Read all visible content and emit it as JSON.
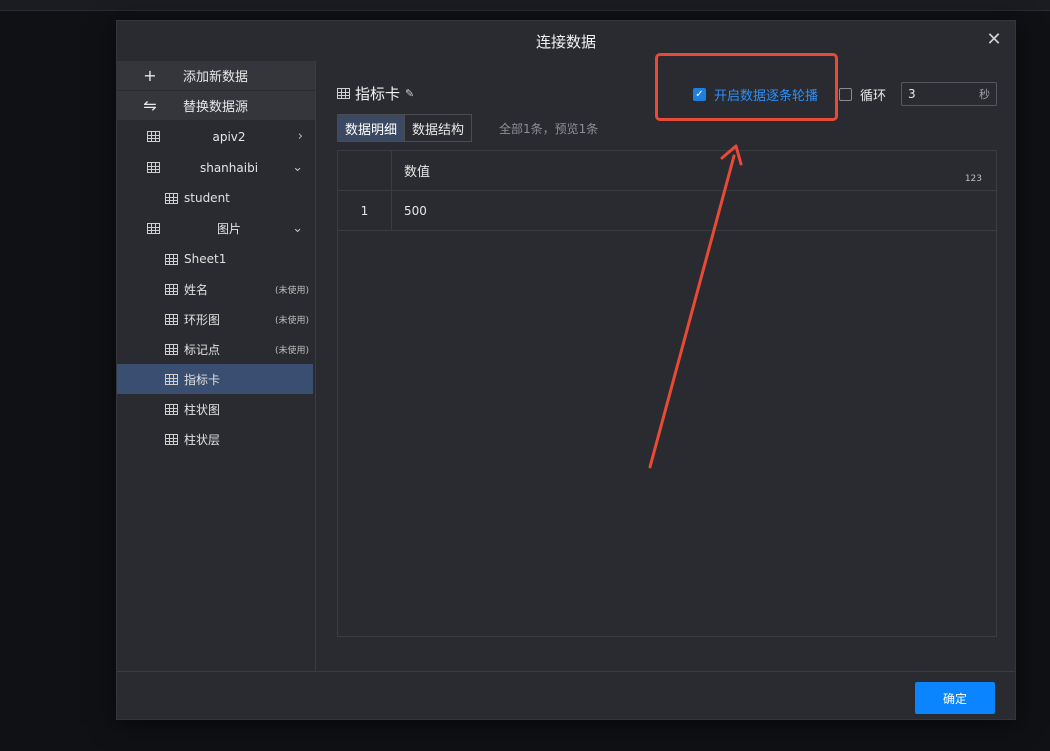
{
  "dialog": {
    "title": "连接数据",
    "close_label": "✕"
  },
  "sidebar": {
    "actions": [
      {
        "icon": "+",
        "label": "添加新数据"
      },
      {
        "icon": "⇋",
        "label": "替换数据源"
      }
    ],
    "sources": [
      {
        "label": "apiv2",
        "chevron": "›"
      },
      {
        "label": "shanhaibi",
        "chevron": "⌄"
      },
      {
        "label": "图片",
        "chevron": "⌄"
      }
    ],
    "shanhaibi_sheets": [
      {
        "label": "student"
      }
    ],
    "image_sheets": [
      {
        "label": "Sheet1",
        "tag": ""
      },
      {
        "label": "姓名",
        "tag": "(未使用)"
      },
      {
        "label": "环形图",
        "tag": "(未使用)"
      },
      {
        "label": "标记点",
        "tag": "(未使用)"
      },
      {
        "label": "指标卡",
        "tag": "",
        "active": true
      },
      {
        "label": "柱状图",
        "tag": ""
      },
      {
        "label": "柱状层",
        "tag": ""
      }
    ]
  },
  "main": {
    "sheet_title": "指标卡",
    "tabs": [
      "数据明细",
      "数据结构"
    ],
    "active_tab": "数据明细",
    "summary": "全部1条，预览1条",
    "rotate_label": "开启数据逐条轮播",
    "rotate_checked": true,
    "loop_label": "循环",
    "loop_checked": false,
    "seconds_value": "3",
    "seconds_unit": "秒",
    "table": {
      "column_header": "数值",
      "column_type": "123",
      "rows": [
        {
          "index": "1",
          "value": "500"
        }
      ]
    }
  },
  "footer": {
    "confirm_label": "确定"
  },
  "colors": {
    "accent": "#0a84ff",
    "annotation": "#e84a35",
    "active_item": "#3a4e72"
  }
}
